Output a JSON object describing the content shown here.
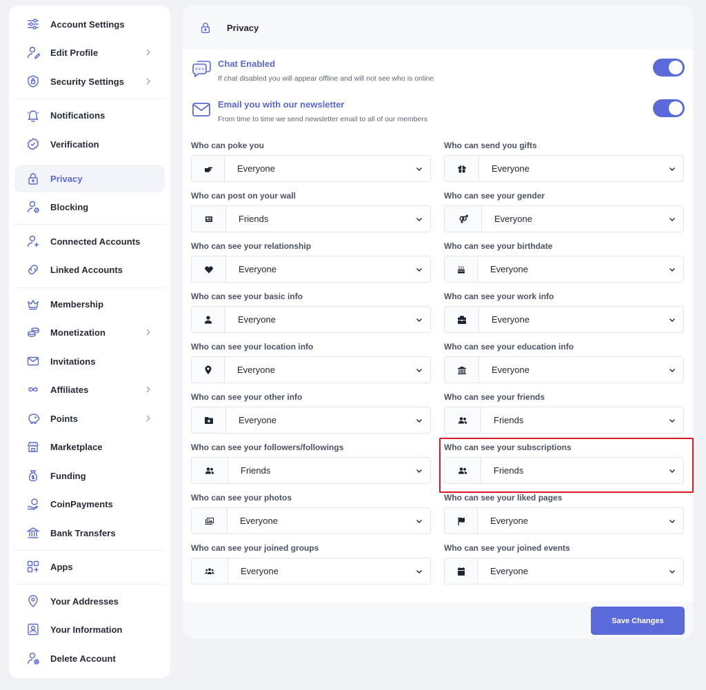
{
  "sidebar": {
    "items": [
      {
        "label": "Account Settings",
        "icon": "sliders-icon"
      },
      {
        "label": "Edit Profile",
        "icon": "user-edit-icon",
        "chevron": true
      },
      {
        "label": "Security Settings",
        "icon": "shield-lock-icon",
        "chevron": true
      },
      {
        "label": "Notifications",
        "icon": "bell-icon"
      },
      {
        "label": "Verification",
        "icon": "badge-check-icon"
      },
      {
        "label": "Privacy",
        "icon": "lock-icon",
        "active": true
      },
      {
        "label": "Blocking",
        "icon": "user-block-icon"
      },
      {
        "label": "Connected Accounts",
        "icon": "user-plus-icon"
      },
      {
        "label": "Linked Accounts",
        "icon": "link-icon"
      },
      {
        "label": "Membership",
        "icon": "crown-icon"
      },
      {
        "label": "Monetization",
        "icon": "coins-icon",
        "chevron": true
      },
      {
        "label": "Invitations",
        "icon": "mail-icon"
      },
      {
        "label": "Affiliates",
        "icon": "infinity-icon",
        "chevron": true
      },
      {
        "label": "Points",
        "icon": "piggy-bank-icon",
        "chevron": true
      },
      {
        "label": "Marketplace",
        "icon": "store-icon"
      },
      {
        "label": "Funding",
        "icon": "money-bag-icon"
      },
      {
        "label": "CoinPayments",
        "icon": "coin-hand-icon"
      },
      {
        "label": "Bank Transfers",
        "icon": "bank-icon"
      },
      {
        "label": "Apps",
        "icon": "apps-grid-icon"
      },
      {
        "label": "Your Addresses",
        "icon": "map-pin-icon"
      },
      {
        "label": "Your Information",
        "icon": "id-card-icon"
      },
      {
        "label": "Delete Account",
        "icon": "user-delete-icon"
      }
    ]
  },
  "panel": {
    "title": "Privacy",
    "icon": "lock-icon"
  },
  "toggles": [
    {
      "title": "Chat Enabled",
      "desc": "If chat disabled you will appear offline and will not see who is online",
      "icon": "chat-icon",
      "on": true
    },
    {
      "title": "Email you with our newsletter",
      "desc": "From time to time we send newsletter email to all of our members",
      "icon": "envelope-icon",
      "on": true
    }
  ],
  "fields": [
    {
      "label": "Who can poke you",
      "value": "Everyone",
      "icon": "hand-point-icon"
    },
    {
      "label": "Who can send you gifts",
      "value": "Everyone",
      "icon": "gift-icon"
    },
    {
      "label": "Who can post on your wall",
      "value": "Friends",
      "icon": "newspaper-icon"
    },
    {
      "label": "Who can see your gender",
      "value": "Everyone",
      "icon": "gender-icon"
    },
    {
      "label": "Who can see your relationship",
      "value": "Everyone",
      "icon": "heart-icon"
    },
    {
      "label": "Who can see your birthdate",
      "value": "Everyone",
      "icon": "cake-icon"
    },
    {
      "label": "Who can see your basic info",
      "value": "Everyone",
      "icon": "user-icon"
    },
    {
      "label": "Who can see your work info",
      "value": "Everyone",
      "icon": "briefcase-icon"
    },
    {
      "label": "Who can see your location info",
      "value": "Everyone",
      "icon": "map-marker-icon"
    },
    {
      "label": "Who can see your education info",
      "value": "Everyone",
      "icon": "university-icon"
    },
    {
      "label": "Who can see your other info",
      "value": "Everyone",
      "icon": "folder-plus-icon"
    },
    {
      "label": "Who can see your friends",
      "value": "Friends",
      "icon": "users-icon"
    },
    {
      "label": "Who can see your followers/followings",
      "value": "Friends",
      "icon": "users-icon"
    },
    {
      "label": "Who can see your subscriptions",
      "value": "Friends",
      "icon": "users-icon"
    },
    {
      "label": "Who can see your photos",
      "value": "Everyone",
      "icon": "images-icon"
    },
    {
      "label": "Who can see your liked pages",
      "value": "Everyone",
      "icon": "flag-icon"
    },
    {
      "label": "Who can see your joined groups",
      "value": "Everyone",
      "icon": "group-icon"
    },
    {
      "label": "Who can see your joined events",
      "value": "Everyone",
      "icon": "calendar-icon"
    }
  ],
  "footer": {
    "save_label": "Save Changes"
  },
  "colors": {
    "accent": "#5b6ad9",
    "highlight": "#d9191f"
  }
}
